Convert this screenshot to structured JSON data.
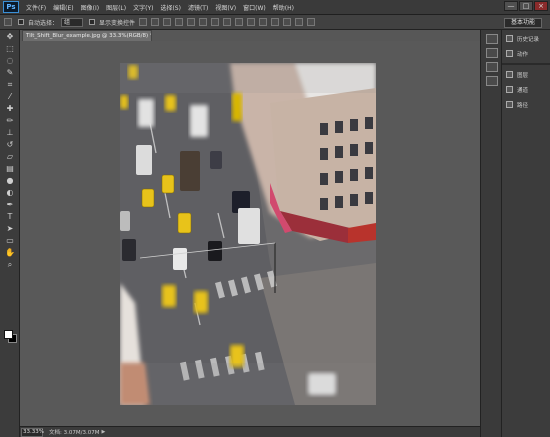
{
  "app": {
    "logo": "Ps"
  },
  "menu": [
    "文件(F)",
    "编辑(E)",
    "图像(I)",
    "图层(L)",
    "文字(Y)",
    "选择(S)",
    "滤镜(T)",
    "视图(V)",
    "窗口(W)",
    "帮助(H)"
  ],
  "window_controls": {
    "minimize": "—",
    "maximize": "□",
    "close": "×"
  },
  "options": {
    "auto_select_label": "自动选择：",
    "auto_select_value": "组",
    "show_transform_label": "显示变换控件",
    "workspace": "基本功能"
  },
  "document": {
    "tab_title": "Tilt_Shift_Blur_example.jpg @ 33.3%(RGB/8) *",
    "zoom": "33.33%",
    "status_info": "文档: 3.07M/3.07M"
  },
  "panels": [
    {
      "icon": "history-icon",
      "label": "历史记录"
    },
    {
      "icon": "actions-icon",
      "label": "动作"
    },
    {
      "icon": "layers-icon",
      "label": "图层"
    },
    {
      "icon": "channels-icon",
      "label": "通道"
    },
    {
      "icon": "paths-icon",
      "label": "路径"
    }
  ],
  "tools": [
    "move-tool-icon",
    "marquee-tool-icon",
    "lasso-tool-icon",
    "quick-select-tool-icon",
    "crop-tool-icon",
    "eyedropper-tool-icon",
    "healing-tool-icon",
    "brush-tool-icon",
    "clone-stamp-tool-icon",
    "history-brush-tool-icon",
    "eraser-tool-icon",
    "gradient-tool-icon",
    "blur-tool-icon",
    "dodge-tool-icon",
    "pen-tool-icon",
    "type-tool-icon",
    "path-select-tool-icon",
    "shape-tool-icon",
    "hand-tool-icon",
    "zoom-tool-icon"
  ]
}
